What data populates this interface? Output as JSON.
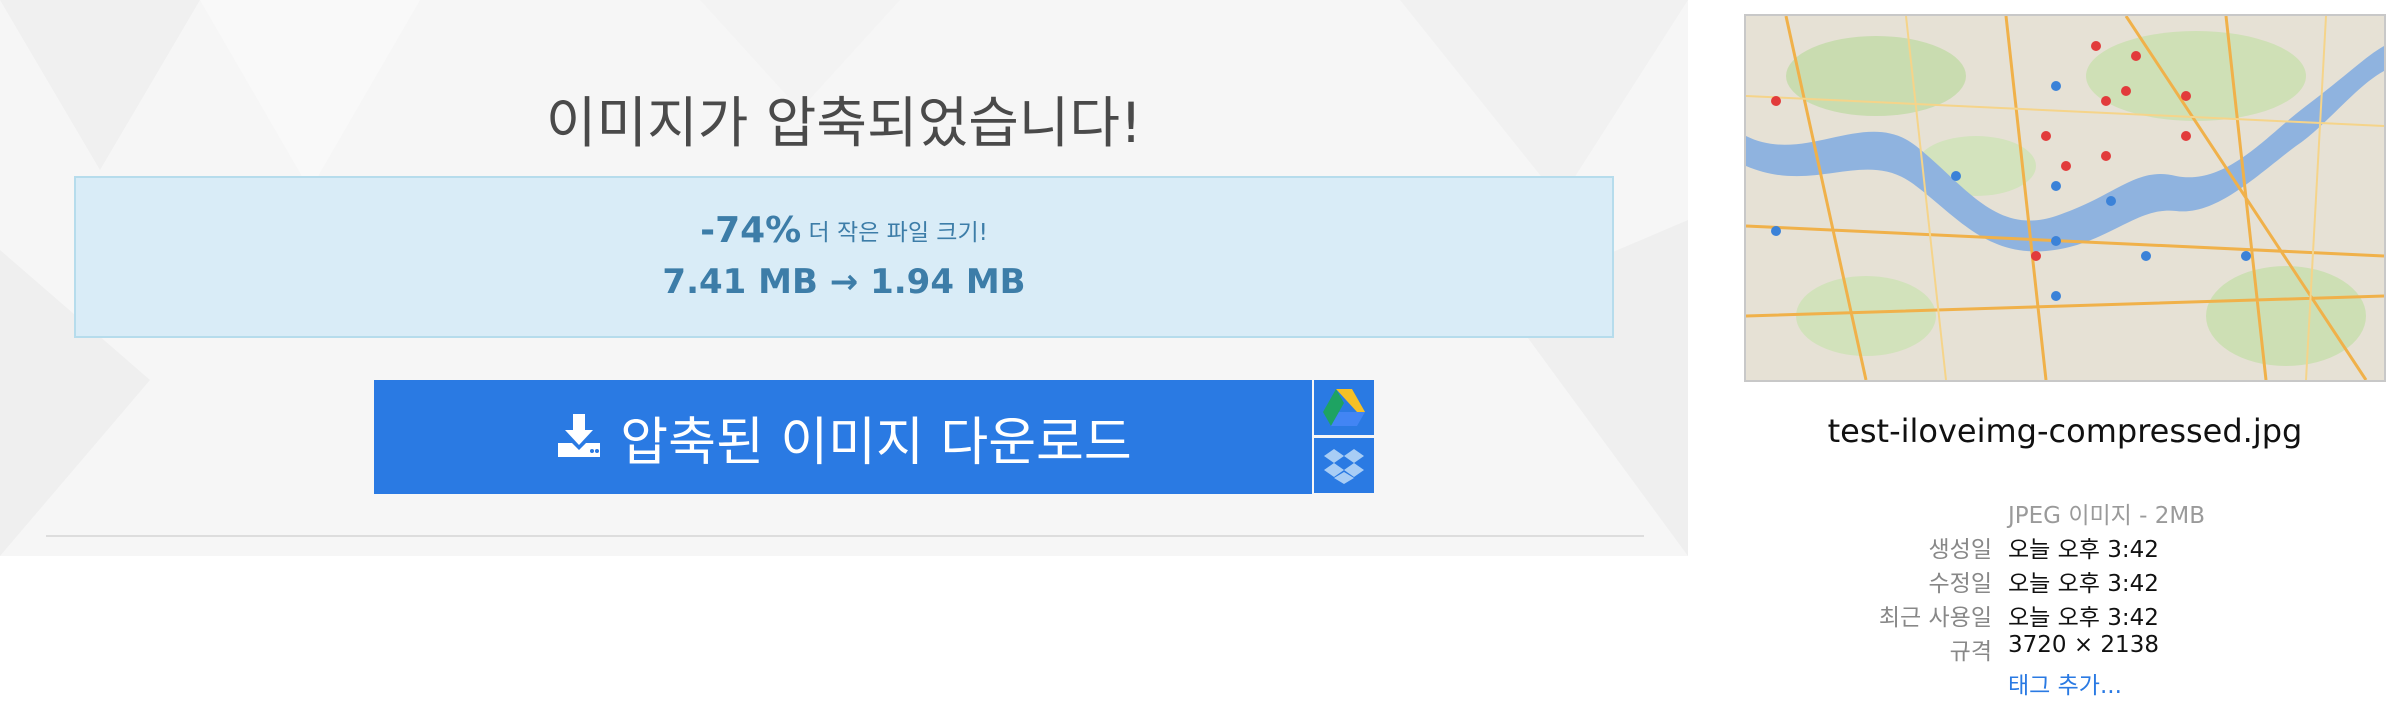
{
  "result": {
    "title": "이미지가 압축되었습니다!",
    "reduction_pct": "-74%",
    "reduction_text": " 더 작은 파일 크기!",
    "original_size": "7.41 MB",
    "arrow": "→",
    "compressed_size": "1.94 MB"
  },
  "download": {
    "button_label": "압축된 이미지 다운로드",
    "icon": "download-icon",
    "cloud_options": [
      {
        "name": "google-drive",
        "icon": "google-drive-icon"
      },
      {
        "name": "dropbox",
        "icon": "dropbox-icon"
      }
    ]
  },
  "file_info": {
    "filename": "test-iloveimg-compressed.jpg",
    "kind": "JPEG 이미지 - 2MB",
    "rows": [
      {
        "key": "생성일",
        "value": "오늘 오후 3:42"
      },
      {
        "key": "수정일",
        "value": "오늘 오후 3:42"
      },
      {
        "key": "최근 사용일",
        "value": "오늘 오후 3:42"
      },
      {
        "key": "규격",
        "value": "3720 × 2138"
      }
    ],
    "add_tags": "태그 추가..."
  },
  "colors": {
    "accent": "#2a7ae3",
    "info_bg": "#d9ecf7",
    "info_text": "#3d7da8",
    "drive_yellow": "#f6c026",
    "drive_green": "#1ea362",
    "drive_blue": "#4285f4"
  }
}
